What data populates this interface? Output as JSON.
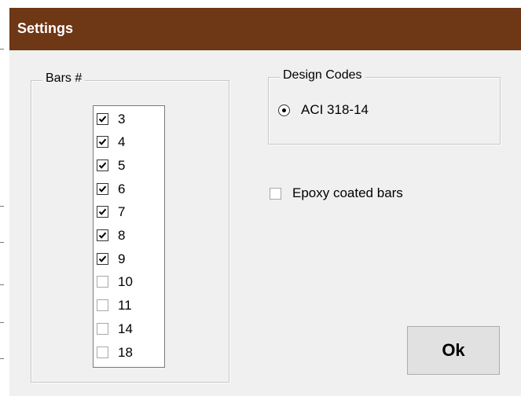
{
  "window": {
    "title": "Settings"
  },
  "bars_group": {
    "legend": "Bars #",
    "items": [
      {
        "label": "3",
        "checked": true
      },
      {
        "label": "4",
        "checked": true
      },
      {
        "label": "5",
        "checked": true
      },
      {
        "label": "6",
        "checked": true
      },
      {
        "label": "7",
        "checked": true
      },
      {
        "label": "8",
        "checked": true
      },
      {
        "label": "9",
        "checked": true
      },
      {
        "label": "10",
        "checked": false
      },
      {
        "label": "11",
        "checked": false
      },
      {
        "label": "14",
        "checked": false
      },
      {
        "label": "18",
        "checked": false
      }
    ]
  },
  "design_codes": {
    "legend": "Design Codes",
    "option_label": "ACI 318-14",
    "selected": true
  },
  "epoxy": {
    "label": "Epoxy coated bars",
    "checked": false
  },
  "ok_button": {
    "label": "Ok"
  },
  "colors": {
    "titlebar": "#6e3716",
    "title_text": "#ffffff",
    "dialog_bg": "#f0f0f0"
  }
}
